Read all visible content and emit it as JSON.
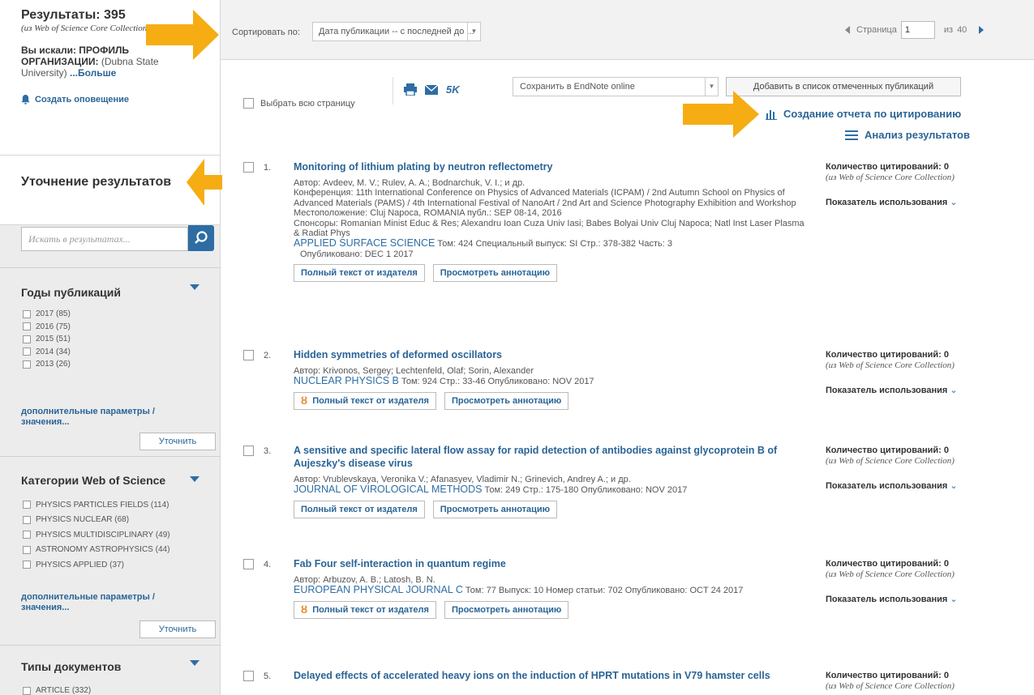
{
  "sidebar": {
    "results_label": "Результаты: 395",
    "results_source": "(из Web of Science Core Collection)",
    "searched_label": "Вы искали: ПРОФИЛЬ ОРГАНИЗАЦИИ:",
    "searched_value": "(Dubna State University)",
    "more": "...Больше",
    "create_alert": "Создать оповещение",
    "refine_title": "Уточнение результатов",
    "search_placeholder": "Искать в результатах...",
    "facets": [
      {
        "title": "Годы публикаций",
        "items": [
          "2017 (85)",
          "2016 (75)",
          "2015 (51)",
          "2014 (34)",
          "2013 (26)"
        ],
        "more": "дополнительные параметры / значения...",
        "refine": "Уточнить"
      },
      {
        "title": "Категории Web of Science",
        "items": [
          "PHYSICS PARTICLES FIELDS (114)",
          "PHYSICS NUCLEAR (68)",
          "PHYSICS MULTIDISCIPLINARY (49)",
          "ASTRONOMY ASTROPHYSICS (44)",
          "PHYSICS APPLIED (37)"
        ],
        "more": "дополнительные параметры / значения...",
        "refine": "Уточнить"
      },
      {
        "title": "Типы документов",
        "items": [
          "ARTICLE (332)"
        ]
      }
    ]
  },
  "sortbar": {
    "sort_label": "Сортировать по:",
    "sort_value": "Дата публикации -- с последней до ...",
    "page_label": "Страница",
    "page_value": "1",
    "page_of": "из",
    "page_total": "40"
  },
  "toolbar": {
    "select_all": "Выбрать всю страницу",
    "count_5k": "5K",
    "save_to": "Сохранить в EndNote online",
    "add_marked": "Добавить в список отмеченных публикаций",
    "citation_report": "Создание отчета по цитированию",
    "analyze": "Анализ результатов"
  },
  "records": [
    {
      "num": "1.",
      "title": "Monitoring of lithium plating by neutron reflectometry",
      "authors": "Автор: Avdeev, M. V.; Rulev, A. A.; Bodnarchuk, V. I.; и др.",
      "conference": "Конференция: 11th International Conference on Physics of Advanced Materials (ICPAM) / 2nd Autumn School on Physics of Advanced Materials (PAMS) / 4th International Festival of NanoArt / 2nd Art and Science Photography Exhibition and Workshop Местоположение: Cluj Napoca, ROMANIA публ.: SEP 08-14, 2016",
      "sponsors": "Спонсоры: Romanian Minist Educ & Res; Alexandru Ioan Cuza Univ Iasi; Babes Bolyai Univ Cluj Napoca; Natl Inst Laser Plasma & Radiat Phys",
      "journal": "APPLIED SURFACE SCIENCE",
      "details": "Том: 424  Специальный выпуск: SI  Стр.: 378-382  Часть: 3",
      "published": "Опубликовано: DEC 1 2017",
      "fulltext": "Полный текст от издателя",
      "abstract": "Просмотреть аннотацию",
      "cites": "Количество цитирований: 0",
      "cites_src": "(из Web of Science Core Collection)",
      "usage": "Показатель использования"
    },
    {
      "num": "2.",
      "title": "Hidden symmetries of deformed oscillators",
      "authors": "Автор: Krivonos, Sergey; Lechtenfeld, Olaf; Sorin, Alexander",
      "journal": "NUCLEAR PHYSICS B",
      "details": "Том: 924  Стр.: 33-46  Опубликовано: NOV 2017",
      "fulltext": "Полный текст от издателя",
      "abstract": "Просмотреть аннотацию",
      "cites": "Количество цитирований: 0",
      "cites_src": "(из Web of Science Core Collection)",
      "usage": "Показатель использования"
    },
    {
      "num": "3.",
      "title": "A sensitive and specific lateral flow assay for rapid detection of antibodies against glycoprotein B of Aujeszky's disease virus",
      "authors": "Автор: Vrublevskaya, Veronika V.; Afanasyev, Vladimir N.; Grinevich, Andrey A.; и др.",
      "journal": "JOURNAL OF VIROLOGICAL METHODS",
      "details": "Том: 249  Стр.: 175-180  Опубликовано: NOV 2017",
      "fulltext": "Полный текст от издателя",
      "abstract": "Просмотреть аннотацию",
      "cites": "Количество цитирований: 0",
      "cites_src": "(из Web of Science Core Collection)",
      "usage": "Показатель использования"
    },
    {
      "num": "4.",
      "title": "Fab Four self-interaction in quantum regime",
      "authors": "Автор: Arbuzov, A. B.; Latosh, B. N.",
      "journal": "EUROPEAN PHYSICAL JOURNAL C",
      "details": "Том: 77  Выпуск: 10  Номер статьи: 702  Опубликовано: OCT 24 2017",
      "fulltext": "Полный текст от издателя",
      "abstract": "Просмотреть аннотацию",
      "cites": "Количество цитирований: 0",
      "cites_src": "(из Web of Science Core Collection)",
      "usage": "Показатель использования"
    },
    {
      "num": "5.",
      "title": "Delayed effects of accelerated heavy ions on the induction of HPRT mutations in V79 hamster cells",
      "cites": "Количество цитирований: 0",
      "cites_src": "(из Web of Science Core Collection)"
    }
  ],
  "colors": {
    "link": "#2a6496",
    "accent": "#2e6da4",
    "arrow": "#f5ad13",
    "open_access": "#e8892b"
  }
}
